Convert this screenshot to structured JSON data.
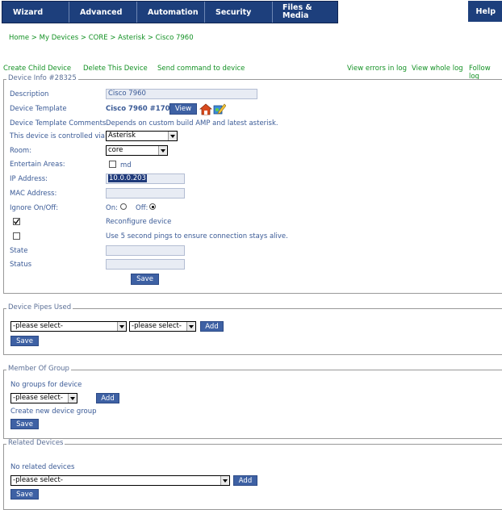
{
  "nav": {
    "tabs": [
      "Wizard",
      "Advanced",
      "Automation",
      "Security",
      "Files & Media"
    ],
    "help": "Help"
  },
  "breadcrumb": "Home > My Devices > CORE > Asterisk > Cisco 7960",
  "actions": {
    "left": [
      "Create Child Device",
      "Delete This Device",
      "Send command to device"
    ],
    "right": [
      "View errors in log",
      "View whole log",
      "Follow log"
    ]
  },
  "device_info": {
    "legend": "Device Info #28325",
    "description_label": "Description",
    "description_value": "Cisco 7960",
    "template_label": "Device Template",
    "template_value": "Cisco 7960 #1700",
    "view_button": "View",
    "comments_label": "Device Template Comments",
    "comments_value": "Depends on custom build AMP and latest asterisk.",
    "controlled_label": "This device is controlled via:",
    "controlled_value": "Asterisk",
    "room_label": "Room:",
    "room_value": "core",
    "entertain_label": "Entertain Areas:",
    "entertain_option": "md",
    "ip_label": "IP Address:",
    "ip_value": "10.0.0.203",
    "mac_label": "MAC Address:",
    "mac_value": "",
    "ignore_label": "Ignore On/Off:",
    "on_label": "On:",
    "off_label": "Off:",
    "reconfigure_label": "Reconfigure device",
    "ping_label": "Use 5 second pings to ensure connection stays alive.",
    "state_label": "State",
    "status_label": "Status",
    "save": "Save"
  },
  "pipes": {
    "legend": "Device Pipes Used",
    "select1": "-please select-",
    "select2": "-please select-",
    "add": "Add",
    "save": "Save"
  },
  "group": {
    "legend": "Member Of Group",
    "empty": "No groups for device",
    "select": "-please select-",
    "add": "Add",
    "create": "Create new device group",
    "save": "Save"
  },
  "related": {
    "legend": "Related Devices",
    "empty": "No related devices",
    "select": "-please select-",
    "add": "Add",
    "save": "Save"
  }
}
